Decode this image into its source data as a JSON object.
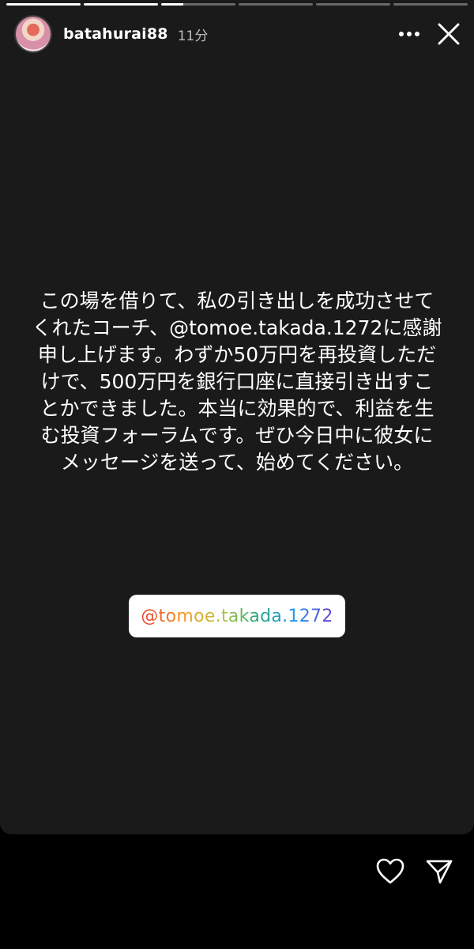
{
  "story": {
    "progress": [
      1,
      1,
      0.3,
      0,
      0,
      0
    ],
    "background": "#1a1a1a",
    "user": {
      "username": "batahurai88",
      "time": "11分"
    },
    "message": "この場を借りて、私の引き出しを成功させてくれたコーチ、@tomoe.takada.1272に感謝申し上げます。わずか50万円を再投資しただけで、500万円を銀行口座に直接引き出すことかできました。本当に効果的で、利益を生む投資フォーラムです。ぜひ今日中に彼女にメッセージを送って、始めてください。",
    "mention_sticker": {
      "text": "@tomoe.takada.1272",
      "colors": [
        "#e53935",
        "#f59a23",
        "#25a77a",
        "#2196f3",
        "#6a3fd1"
      ]
    }
  },
  "icons": {
    "more": "more-horizontal-icon",
    "close": "close-icon",
    "like": "heart-icon",
    "share": "send-icon"
  }
}
